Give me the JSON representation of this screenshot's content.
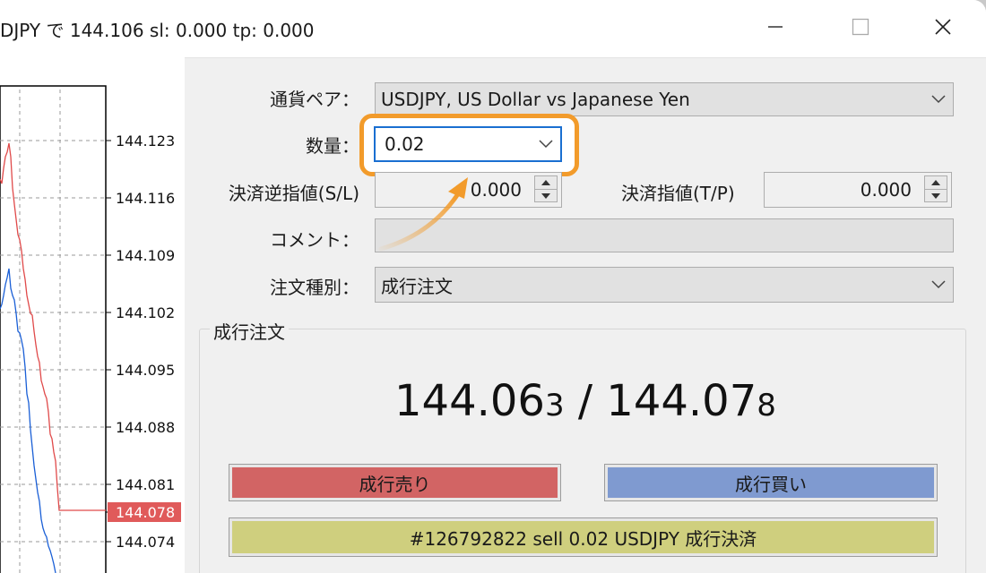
{
  "title": "DJPY で 144.106 sl: 0.000 tp: 0.000",
  "window_buttons": {
    "minimize": "minimize-icon",
    "maximize": "maximize-icon",
    "close": "close-icon"
  },
  "chart": {
    "price_labels": [
      "144.123",
      "144.116",
      "144.109",
      "144.102",
      "144.095",
      "144.088",
      "144.081",
      "144.078",
      "144.074"
    ],
    "current_price": "144.078",
    "current_price_color": "#e05a5a",
    "bid_color": "#1a5fd6",
    "ask_color": "#e04a4a"
  },
  "form": {
    "symbol_label": "通貨ペア：",
    "symbol_value": "USDJPY, US Dollar vs Japanese Yen",
    "volume_label": "数量：",
    "volume_value": "0.02",
    "sl_label": "決済逆指値(S/L)",
    "sl_value": "0.000",
    "tp_label": "決済指値(T/P)",
    "tp_value": "0.000",
    "comment_label": "コメント：",
    "comment_value": "",
    "type_label": "注文種別：",
    "type_value": "成行注文"
  },
  "market": {
    "group_title": "成行注文",
    "bid_main": "144.06",
    "bid_small": "3",
    "separator": " / ",
    "ask_main": "144.07",
    "ask_small": "8",
    "sell_label": "成行売り",
    "sell_color": "#d26464",
    "buy_label": "成行買い",
    "buy_color": "#7f9ad0",
    "close_label": "#126792822 sell 0.02 USDJPY 成行決済",
    "close_color": "#cfcf7e"
  },
  "highlight_color": "#f29b2b"
}
